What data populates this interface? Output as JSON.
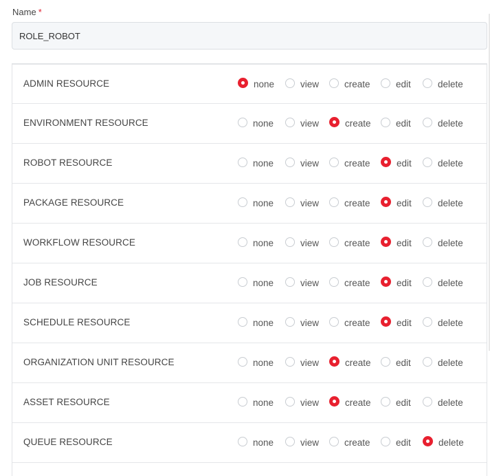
{
  "form": {
    "name_label": "Name",
    "required_mark": "*",
    "name_value": "ROLE_ROBOT"
  },
  "option_labels": [
    "none",
    "view",
    "create",
    "edit",
    "delete"
  ],
  "accent_color": "#e8202f",
  "permissions": [
    {
      "resource": "ADMIN RESOURCE",
      "selected": "none"
    },
    {
      "resource": "ENVIRONMENT RESOURCE",
      "selected": "create"
    },
    {
      "resource": "ROBOT RESOURCE",
      "selected": "edit"
    },
    {
      "resource": "PACKAGE RESOURCE",
      "selected": "edit"
    },
    {
      "resource": "WORKFLOW RESOURCE",
      "selected": "edit"
    },
    {
      "resource": "JOB RESOURCE",
      "selected": "edit"
    },
    {
      "resource": "SCHEDULE RESOURCE",
      "selected": "edit"
    },
    {
      "resource": "ORGANIZATION UNIT RESOURCE",
      "selected": "create"
    },
    {
      "resource": "ASSET RESOURCE",
      "selected": "create"
    },
    {
      "resource": "QUEUE RESOURCE",
      "selected": "delete"
    }
  ]
}
